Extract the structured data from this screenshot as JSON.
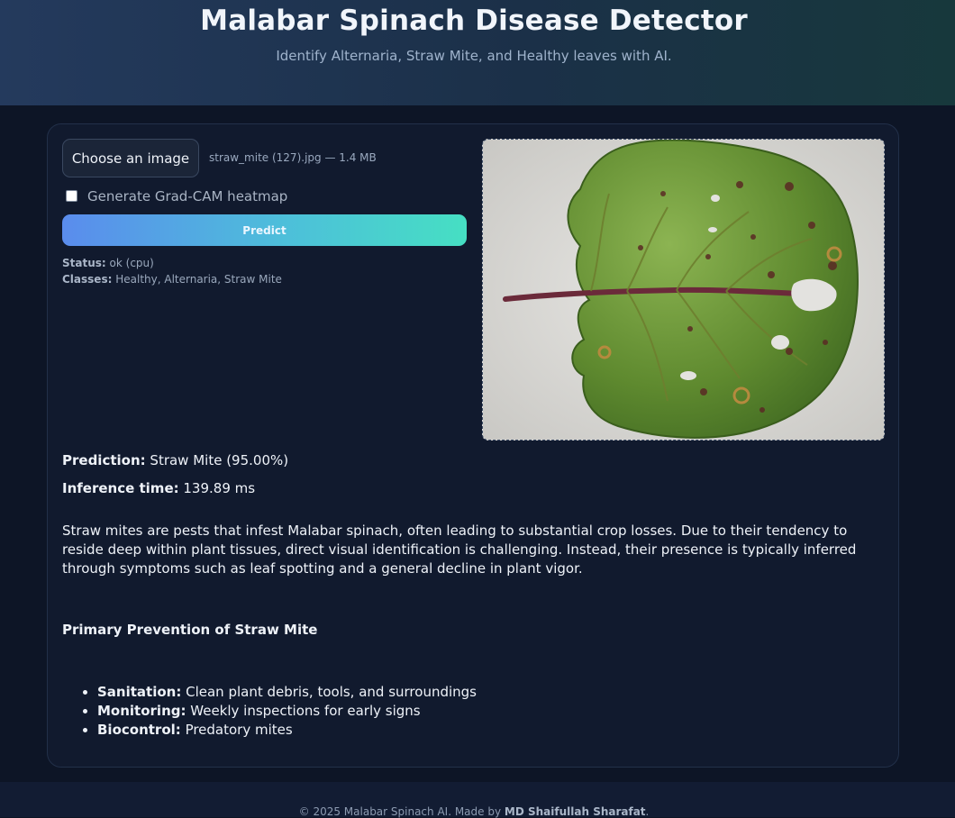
{
  "header": {
    "title": "Malabar Spinach Disease Detector",
    "subtitle": "Identify Alternaria, Straw Mite, and Healthy leaves with AI."
  },
  "upload": {
    "choose_label": "Choose an image",
    "file_info": "straw_mite (127).jpg — 1.4 MB"
  },
  "gradcam": {
    "label": "Generate Grad-CAM heatmap",
    "checked": false
  },
  "predict_label": "Predict",
  "status": {
    "status_key": "Status:",
    "status_value": "ok (cpu)",
    "classes_key": "Classes:",
    "classes_value": "Healthy, Alternaria, Straw Mite"
  },
  "result": {
    "prediction_key": "Prediction:",
    "prediction_value": "Straw Mite (95.00%)",
    "inference_key": "Inference time:",
    "inference_value": "139.89 ms"
  },
  "description": "Straw mites are pests that infest Malabar spinach, often leading to substantial crop losses. Due to their tendency to reside deep within plant tissues, direct visual identification is challenging. Instead, their presence is typically inferred through symptoms such as leaf spotting and a general decline in plant vigor.",
  "prevention": {
    "heading": "Primary Prevention of Straw Mite",
    "items": [
      {
        "key": "Sanitation:",
        "text": "Clean plant debris, tools, and surroundings"
      },
      {
        "key": "Monitoring:",
        "text": "Weekly inspections for early signs"
      },
      {
        "key": "Biocontrol:",
        "text": "Predatory mites"
      }
    ]
  },
  "footer": {
    "prefix": "© 2025 Malabar Spinach AI. Made by",
    "author": "MD Shaifullah Sharafat",
    "suffix": "."
  },
  "colors": {
    "page_bg": "#0c1425",
    "card_bg": "#111a2e",
    "predict_gradient_start": "#5a8ced",
    "predict_gradient_end": "#46dfc3"
  }
}
